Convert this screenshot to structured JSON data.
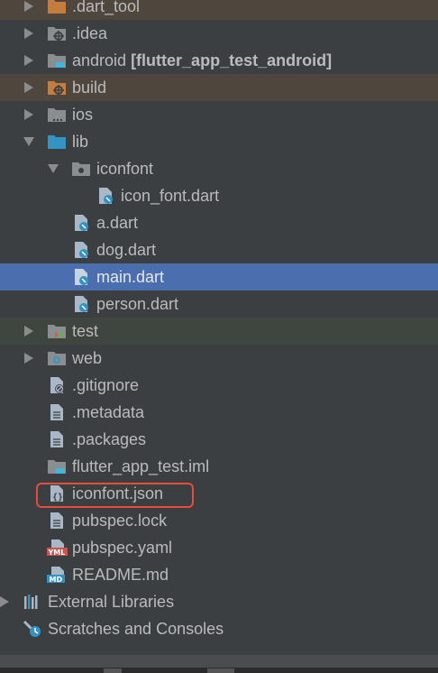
{
  "tree": {
    "items": [
      {
        "label": ".dart_tool",
        "name": "tree-item-dart-tool",
        "icon": "folder-orange-icon"
      },
      {
        "label": ".idea",
        "name": "tree-item-idea",
        "icon": "folder-idea-icon"
      },
      {
        "label": "android",
        "suffix": "[flutter_app_test_android]",
        "name": "tree-item-android",
        "icon": "folder-module-icon"
      },
      {
        "label": "build",
        "name": "tree-item-build",
        "icon": "folder-orange-icon"
      },
      {
        "label": "ios",
        "name": "tree-item-ios",
        "icon": "folder-ios-icon"
      },
      {
        "label": "lib",
        "name": "tree-item-lib",
        "icon": "folder-source-icon"
      },
      {
        "label": "iconfont",
        "name": "tree-item-iconfont",
        "icon": "package-folder-icon"
      },
      {
        "label": "icon_font.dart",
        "name": "tree-item-icon-font-dart",
        "icon": "dart-file-icon"
      },
      {
        "label": "a.dart",
        "name": "tree-item-a-dart",
        "icon": "dart-file-icon"
      },
      {
        "label": "dog.dart",
        "name": "tree-item-dog-dart",
        "icon": "dart-file-icon"
      },
      {
        "label": "main.dart",
        "name": "tree-item-main-dart",
        "icon": "dart-file-icon"
      },
      {
        "label": "person.dart",
        "name": "tree-item-person-dart",
        "icon": "dart-file-icon"
      },
      {
        "label": "test",
        "name": "tree-item-test",
        "icon": "folder-test-icon"
      },
      {
        "label": "web",
        "name": "tree-item-web",
        "icon": "folder-web-icon"
      },
      {
        "label": ".gitignore",
        "name": "tree-item-gitignore",
        "icon": "gitignore-file-icon"
      },
      {
        "label": ".metadata",
        "name": "tree-item-metadata",
        "icon": "text-file-icon"
      },
      {
        "label": ".packages",
        "name": "tree-item-packages",
        "icon": "text-file-icon"
      },
      {
        "label": "flutter_app_test.iml",
        "name": "tree-item-iml",
        "icon": "iml-file-icon"
      },
      {
        "label": "iconfont.json",
        "name": "tree-item-iconfont-json",
        "icon": "json-file-icon"
      },
      {
        "label": "pubspec.lock",
        "name": "tree-item-pubspec-lock",
        "icon": "text-file-icon"
      },
      {
        "label": "pubspec.yaml",
        "name": "tree-item-pubspec-yaml",
        "icon": "yaml-file-icon"
      },
      {
        "label": "README.md",
        "name": "tree-item-readme",
        "icon": "markdown-file-icon"
      },
      {
        "label": "External Libraries",
        "name": "tree-item-external-libraries",
        "icon": "libraries-icon"
      },
      {
        "label": "Scratches and Consoles",
        "name": "tree-item-scratches",
        "icon": "scratches-icon"
      }
    ]
  },
  "icon_badges": {
    "yaml": "YML",
    "markdown": "MD",
    "json": "{}"
  },
  "colors": {
    "panel_background": "#3c3f41",
    "selection": "#4b6eaf",
    "excluded_folder_row": "#4f463e",
    "test_folder_row": "#3f4640",
    "highlight_border": "#e74c3c"
  }
}
